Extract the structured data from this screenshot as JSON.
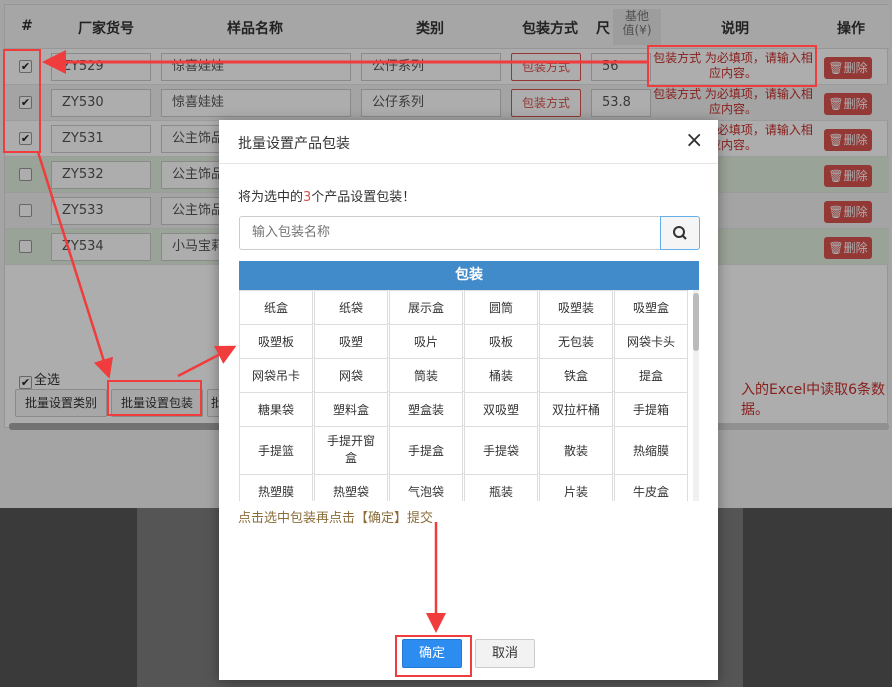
{
  "table": {
    "headers": {
      "index": "#",
      "code": "厂家货号",
      "name": "样品名称",
      "category": "类别",
      "package": "包装方式",
      "size_line1": "尺",
      "size_line2": "(¥)",
      "desc": "说明",
      "action": "操作"
    },
    "hidden_label": "基他\n值(¥)",
    "rows": [
      {
        "checked": true,
        "code": "ZY529",
        "name": "惊喜娃娃",
        "category": "公仔系列",
        "package": "包装方式",
        "price": "56",
        "note": "包装方式 为必填项，请输入相应内容。",
        "delete": "删除"
      },
      {
        "checked": true,
        "code": "ZY530",
        "name": "惊喜娃娃",
        "category": "公仔系列",
        "package": "包装方式",
        "price": "53.8",
        "note": "包装方式 为必填项，请输入相应内容。",
        "delete": "删除"
      },
      {
        "checked": true,
        "code": "ZY531",
        "name": "公主饰品",
        "category": "",
        "package": "",
        "price": "",
        "note": "包装方式 为必填项，请输入相应内容。",
        "delete": "删除"
      },
      {
        "checked": false,
        "code": "ZY532",
        "name": "公主饰品",
        "category": "",
        "package": "",
        "price": "",
        "note": "",
        "delete": "删除"
      },
      {
        "checked": false,
        "code": "ZY533",
        "name": "公主饰品",
        "category": "",
        "package": "",
        "price": "",
        "note": "",
        "delete": "删除"
      },
      {
        "checked": false,
        "code": "ZY534",
        "name": "小马宝莉",
        "category": "",
        "package": "",
        "price": "",
        "note": "",
        "delete": "删除"
      }
    ],
    "select_all": "全选",
    "bulk_category": "批量设置类别",
    "bulk_package": "批量设置包装",
    "bulk_more": "批",
    "import_msg": "入的Excel中读取6条数据。"
  },
  "modal": {
    "title": "批量设置产品包装",
    "close": "×",
    "tip_prefix": "将为选中的",
    "tip_count": "3",
    "tip_suffix": "个产品设置包装！",
    "search_placeholder": "输入包装名称",
    "grid_header": "包装",
    "packages": [
      [
        "纸盒",
        "纸袋",
        "展示盒",
        "圆筒",
        "吸塑装",
        "吸塑盒"
      ],
      [
        "吸塑板",
        "吸塑",
        "吸片",
        "吸板",
        "无包装",
        "网袋卡头"
      ],
      [
        "网袋吊卡",
        "网袋",
        "筒装",
        "桶装",
        "铁盒",
        "提盒"
      ],
      [
        "糖果袋",
        "塑料盒",
        "塑盒装",
        "双吸塑",
        "双拉杆桶",
        "手提箱"
      ],
      [
        "手提篮",
        "手提开窗盒",
        "手提盒",
        "手提袋",
        "散装",
        "热缩膜"
      ],
      [
        "热塑膜",
        "热塑袋",
        "气泡袋",
        "瓶装",
        "片装",
        "牛皮盒"
      ]
    ],
    "hint": "点击选中包装再点击【确定】提交",
    "ok": "确定",
    "cancel": "取消"
  },
  "colors": {
    "primary": "#428bca",
    "danger": "#d9534f",
    "annotation": "#f03c3c",
    "ok": "#2d8cf0"
  }
}
